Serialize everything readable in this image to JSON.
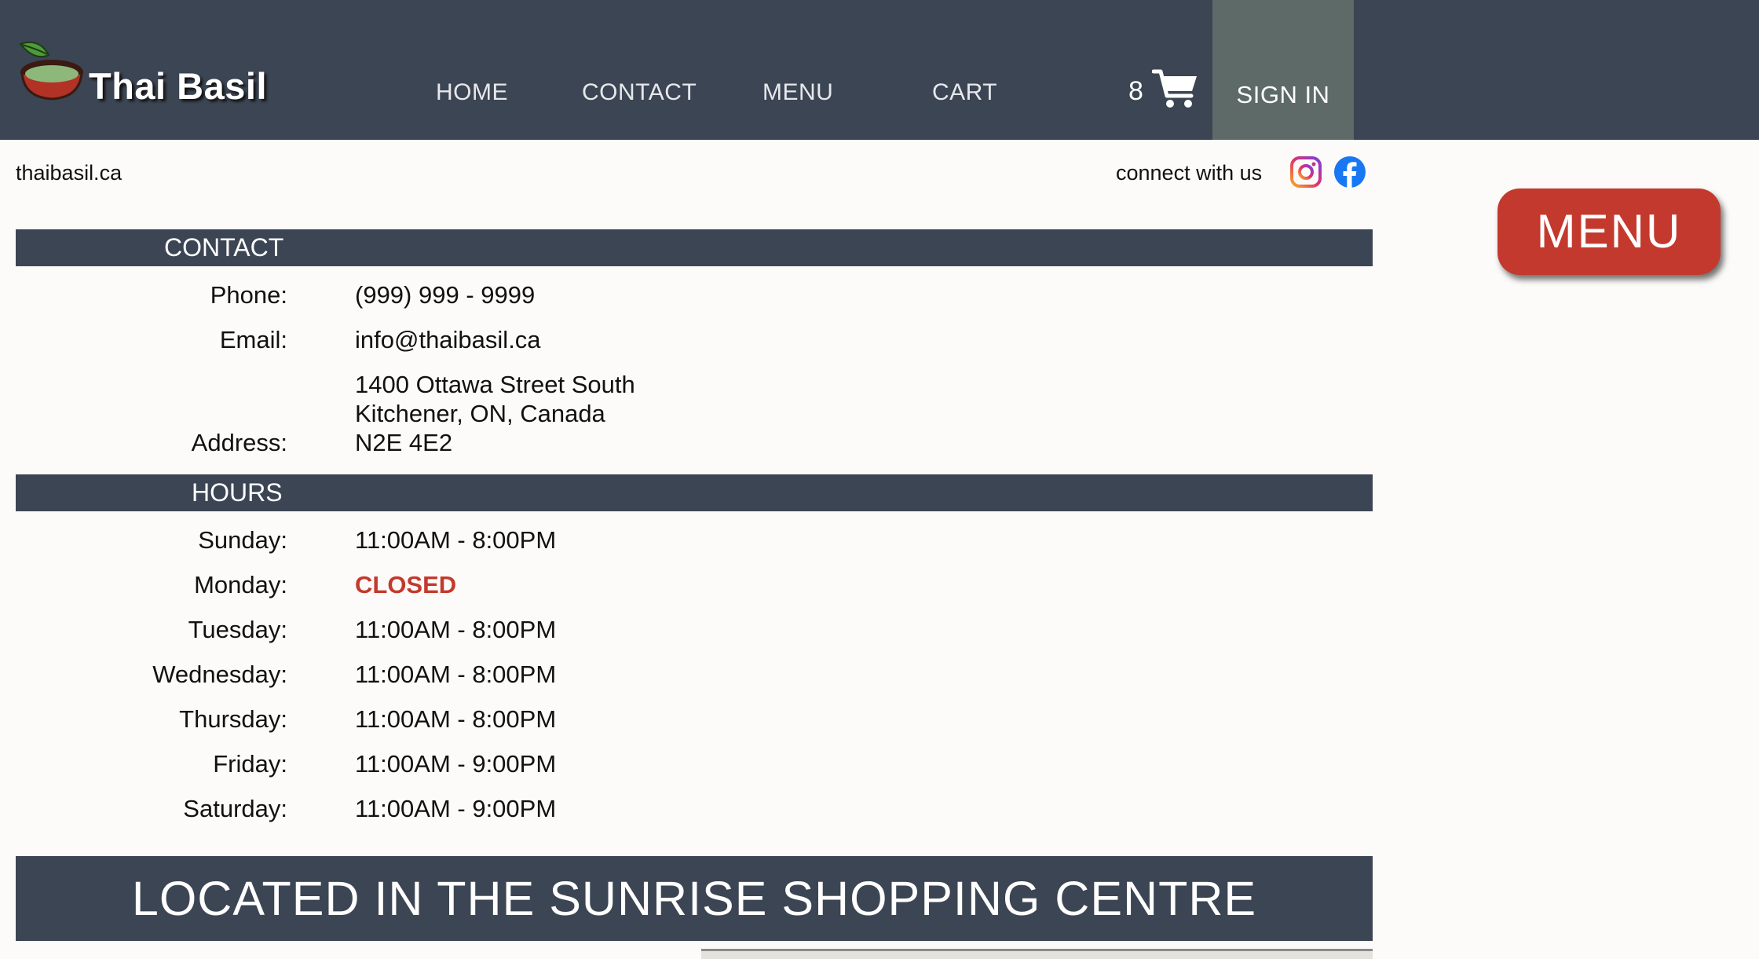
{
  "header": {
    "brand": "Thai Basil",
    "nav": [
      "HOME",
      "CONTACT",
      "MENU",
      "CART"
    ],
    "cart_count": "8",
    "sign_in": "SIGN IN"
  },
  "subheader": {
    "site_url": "thaibasil.ca",
    "connect": "connect with us"
  },
  "menu_button": "MENU",
  "contact": {
    "heading": "CONTACT",
    "phone_label": "Phone:",
    "phone": "(999) 999 - 9999",
    "email_label": "Email:",
    "email": "info@thaibasil.ca",
    "address_label": "Address:",
    "address_lines": [
      "1400 Ottawa Street South",
      "Kitchener, ON, Canada",
      "N2E 4E2"
    ]
  },
  "hours": {
    "heading": "HOURS",
    "days": [
      {
        "day": "Sunday:",
        "time": "11:00AM - 8:00PM"
      },
      {
        "day": "Monday:",
        "time": "CLOSED"
      },
      {
        "day": "Tuesday:",
        "time": "11:00AM - 8:00PM"
      },
      {
        "day": "Wednesday:",
        "time": "11:00AM - 8:00PM"
      },
      {
        "day": "Thursday:",
        "time": "11:00AM - 8:00PM"
      },
      {
        "day": "Friday:",
        "time": "11:00AM - 9:00PM"
      },
      {
        "day": "Saturday:",
        "time": "11:00AM - 9:00PM"
      }
    ]
  },
  "location_banner": "LOCATED IN THE SUNRISE SHOPPING CENTRE",
  "colors": {
    "header_bg": "#3c4553",
    "sign_in_bg": "#5e6a68",
    "accent_red": "#c4392d"
  },
  "icons": [
    "bowl-logo-icon",
    "cart-icon",
    "instagram-icon",
    "facebook-icon"
  ]
}
